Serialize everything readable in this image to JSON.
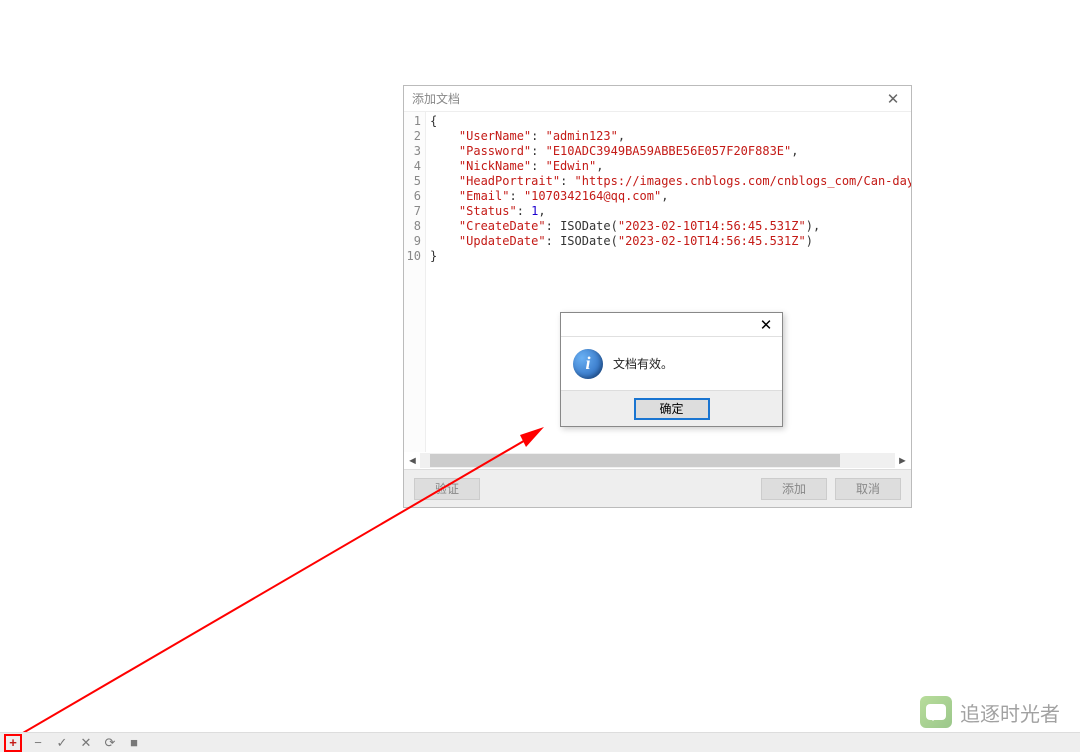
{
  "dialog": {
    "title": "添加文档",
    "close": "✕",
    "document": {
      "fields": [
        {
          "key": "UserName",
          "type": "string",
          "value": "admin123"
        },
        {
          "key": "Password",
          "type": "string",
          "value": "E10ADC3949BA59ABBE56E057F20F883E"
        },
        {
          "key": "NickName",
          "type": "string",
          "value": "Edwin"
        },
        {
          "key": "HeadPortrait",
          "type": "string",
          "value": "https://images.cnblogs.com/cnblogs_com/Can-daydayup/"
        },
        {
          "key": "Email",
          "type": "string",
          "value": "1070342164@qq.com"
        },
        {
          "key": "Status",
          "type": "number",
          "value": 1
        },
        {
          "key": "CreateDate",
          "type": "isodate",
          "value": "2023-02-10T14:56:45.531Z"
        },
        {
          "key": "UpdateDate",
          "type": "isodate",
          "value": "2023-02-10T14:56:45.531Z"
        }
      ],
      "iso_fn": "ISODate"
    },
    "scroll_left": "◄",
    "scroll_right": "►",
    "buttons": {
      "validate": "验证",
      "add": "添加",
      "cancel": "取消"
    }
  },
  "msgbox": {
    "close": "✕",
    "icon_glyph": "i",
    "text": "文档有效。",
    "ok": "确定"
  },
  "toolbar": {
    "add": "+",
    "remove": "−",
    "check": "✓",
    "cross": "✕",
    "reload": "⟳",
    "stop": "■"
  },
  "watermark": "追逐时光者"
}
